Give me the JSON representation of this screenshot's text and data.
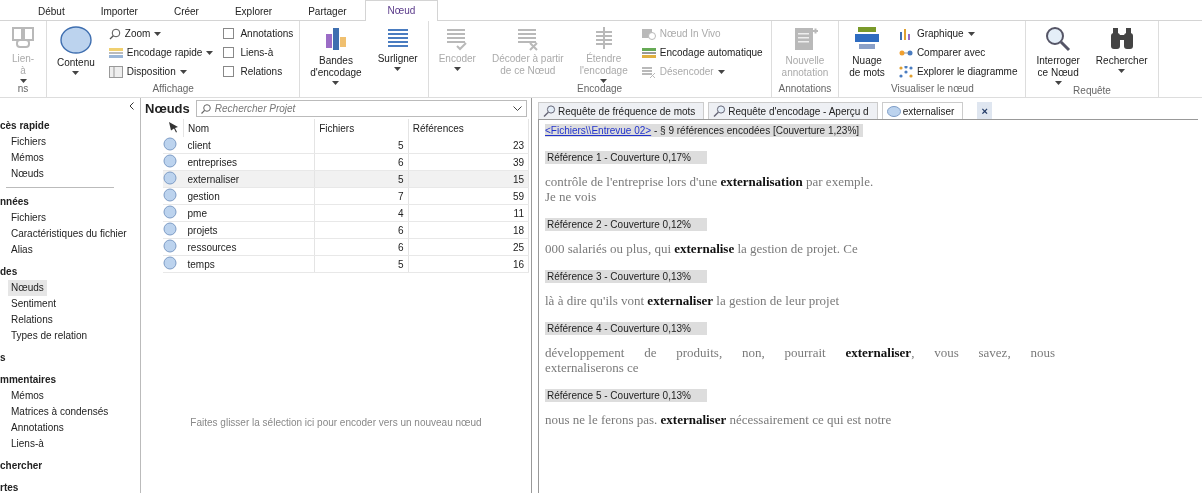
{
  "ribbon_tabs": [
    {
      "label": "Début",
      "selected": false
    },
    {
      "label": "Importer",
      "selected": false
    },
    {
      "label": "Créer",
      "selected": false
    },
    {
      "label": "Explorer",
      "selected": false
    },
    {
      "label": "Partager",
      "selected": false
    },
    {
      "label": "Nœud",
      "selected": true
    }
  ],
  "ribbon_groups": [
    {
      "label": "ns",
      "columns": [
        {
          "items": [
            {
              "kind": "large",
              "label": "Lien-\nà",
              "disabled": true,
              "dropdown": true
            }
          ]
        }
      ]
    },
    {
      "label": "Affichage",
      "columns": [
        {
          "items": [
            {
              "kind": "large",
              "label": "Contenu",
              "disabled": false,
              "dropdown": true
            }
          ]
        },
        {
          "items": [
            {
              "kind": "small",
              "label": "Zoom",
              "disabled": false,
              "dropdown": true
            },
            {
              "kind": "small",
              "label": "Encodage rapide",
              "disabled": false,
              "dropdown": true
            },
            {
              "kind": "small",
              "label": "Disposition",
              "disabled": false,
              "dropdown": true
            }
          ]
        },
        {
          "items": [
            {
              "kind": "checkbox",
              "label": "Annotations",
              "checked": false
            },
            {
              "kind": "checkbox",
              "label": "Liens-à",
              "checked": false
            },
            {
              "kind": "checkbox",
              "label": "Relations",
              "checked": false
            }
          ]
        }
      ]
    },
    {
      "columns": [
        {
          "items": [
            {
              "kind": "large",
              "label": "Bandes\nd'encodage",
              "disabled": false,
              "dropdown": true
            }
          ]
        },
        {
          "items": [
            {
              "kind": "large",
              "label": "Surligner",
              "disabled": false,
              "dropdown": true
            }
          ]
        }
      ]
    },
    {
      "label": "Encodage",
      "columns": [
        {
          "items": [
            {
              "kind": "large",
              "label": "Encoder",
              "disabled": true,
              "dropdown": true
            }
          ]
        },
        {
          "items": [
            {
              "kind": "large",
              "label": "Décoder à partir\nde ce Nœud",
              "disabled": true,
              "dropdown": false
            }
          ]
        },
        {
          "items": [
            {
              "kind": "large",
              "label": "Étendre\nl'encodage",
              "disabled": true,
              "dropdown": true
            }
          ]
        },
        {
          "items": [
            {
              "kind": "small",
              "label": "Nœud In Vivo",
              "disabled": true,
              "dropdown": false
            },
            {
              "kind": "small",
              "label": "Encodage automatique",
              "disabled": false,
              "dropdown": false
            },
            {
              "kind": "small",
              "label": "Désencoder",
              "disabled": true,
              "dropdown": true
            }
          ]
        }
      ]
    },
    {
      "label": "Annotations",
      "columns": [
        {
          "items": [
            {
              "kind": "large",
              "label": "Nouvelle\nannotation",
              "disabled": true,
              "dropdown": false
            }
          ]
        }
      ]
    },
    {
      "label": "Visualiser le nœud",
      "columns": [
        {
          "items": [
            {
              "kind": "large",
              "label": "Nuage\nde mots",
              "disabled": false,
              "dropdown": false
            }
          ]
        },
        {
          "items": [
            {
              "kind": "small",
              "label": "Graphique",
              "disabled": false,
              "dropdown": true
            },
            {
              "kind": "small",
              "label": "Comparer avec",
              "disabled": false,
              "dropdown": false
            },
            {
              "kind": "small",
              "label": "Explorer le diagramme",
              "disabled": false,
              "dropdown": false
            }
          ]
        }
      ]
    },
    {
      "label": "Requête",
      "columns": [
        {
          "items": [
            {
              "kind": "large",
              "label": "Interroger\nce Nœud",
              "disabled": false,
              "dropdown": true
            }
          ]
        },
        {
          "items": [
            {
              "kind": "large",
              "label": "Rechercher",
              "disabled": false,
              "dropdown": true
            }
          ]
        }
      ]
    }
  ],
  "sidebar": {
    "sections": [
      {
        "heading": "cès rapide",
        "items": [
          {
            "label": "Fichiers",
            "selected": false
          },
          {
            "label": "Mémos",
            "selected": false
          },
          {
            "label": "Nœuds",
            "selected": false
          }
        ]
      },
      {
        "heading": "nnées",
        "items": [
          {
            "label": "Fichiers",
            "selected": false
          },
          {
            "label": "Caractéristiques du fichier",
            "selected": false
          },
          {
            "label": "Alias",
            "selected": false
          }
        ]
      },
      {
        "heading": "des",
        "items": [
          {
            "label": "Nœuds",
            "selected": true
          },
          {
            "label": "Sentiment",
            "selected": false
          },
          {
            "label": "Relations",
            "selected": false
          },
          {
            "label": "Types de relation",
            "selected": false
          }
        ]
      },
      {
        "heading": "s"
      },
      {
        "heading": "mmentaires",
        "items": [
          {
            "label": "Mémos",
            "selected": false
          },
          {
            "label": "Matrices à condensés",
            "selected": false
          },
          {
            "label": "Annotations",
            "selected": false
          },
          {
            "label": "Liens-à",
            "selected": false
          }
        ]
      },
      {
        "heading": "chercher"
      },
      {
        "heading": "rtes"
      }
    ]
  },
  "nodes": {
    "title": "Nœuds",
    "search": {
      "placeholder": "Rechercher Projet"
    },
    "columns": [
      "Nom",
      "Fichiers",
      "Références"
    ],
    "rows": [
      {
        "name": "client",
        "files": "5",
        "references": "23",
        "selected": false
      },
      {
        "name": "entreprises",
        "files": "6",
        "references": "39",
        "selected": false
      },
      {
        "name": "externaliser",
        "files": "5",
        "references": "15",
        "selected": true
      },
      {
        "name": "gestion",
        "files": "7",
        "references": "59",
        "selected": false
      },
      {
        "name": "pme",
        "files": "4",
        "references": "11",
        "selected": false
      },
      {
        "name": "projets",
        "files": "6",
        "references": "18",
        "selected": false
      },
      {
        "name": "ressources",
        "files": "6",
        "references": "25",
        "selected": false
      },
      {
        "name": "temps",
        "files": "5",
        "references": "16",
        "selected": false
      }
    ],
    "drop_hint": "Faites glisser la sélection ici pour encoder vers un nouveau nœud"
  },
  "detail": {
    "tabs": [
      {
        "label": "Requête de fréquence de mots",
        "kind": "query",
        "selected": false
      },
      {
        "label": "Requête d'encodage - Aperçu d",
        "kind": "query",
        "selected": false
      },
      {
        "label": "externaliser",
        "kind": "node",
        "selected": true
      }
    ],
    "close_button": "×",
    "source_link": "<Fichiers\\\\Entrevue 02>",
    "summary": " - § 9 références encodées  [Couverture 1,23%]",
    "references": [
      {
        "heading": "Référence 1 - Couverture 0,17%",
        "lines": [
          "contrôle de l'entreprise lors d'une **externalisation** par exemple.",
          "Je ne vois"
        ]
      },
      {
        "heading": "Référence 2 - Couverture 0,12%",
        "lines": [
          "000 salariés ou plus, qui **externalise** la gestion de projet. Ce"
        ]
      },
      {
        "heading": "Référence 3 - Couverture 0,13%",
        "lines": [
          "là à dire qu'ils vont **externaliser** la gestion de leur projet"
        ]
      },
      {
        "heading": "Référence 4 - Couverture 0,13%",
        "lines": [
          "développement de produits, non, pourrait **externaliser**, vous savez, nous",
          "externaliserons ce"
        ],
        "justified": true
      },
      {
        "heading": "Référence 5 - Couverture 0,13%",
        "lines": [
          "nous ne le ferons pas. **externaliser** nécessairement ce qui est notre"
        ]
      }
    ]
  }
}
